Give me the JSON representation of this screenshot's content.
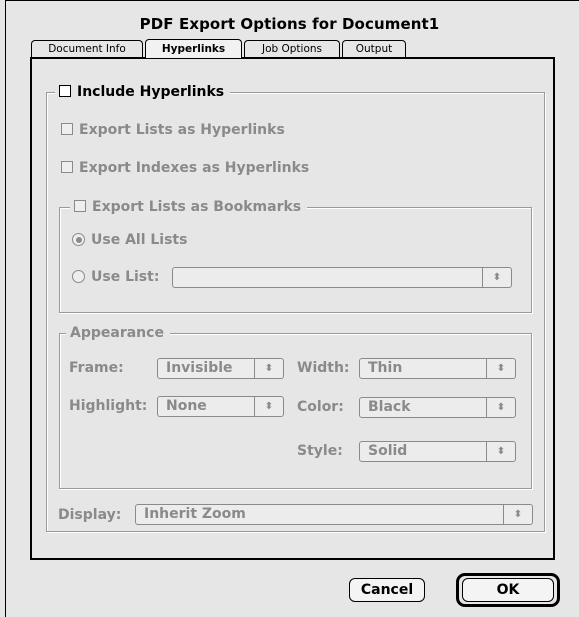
{
  "dialog": {
    "title": "PDF Export Options for Document1",
    "tabs": [
      {
        "label": "Document Info",
        "active": false
      },
      {
        "label": "Hyperlinks",
        "active": true
      },
      {
        "label": "Job Options",
        "active": false
      },
      {
        "label": "Output",
        "active": false
      }
    ]
  },
  "hyperlinks": {
    "include_label": "Include Hyperlinks",
    "include_checked": false,
    "export_lists_label": "Export Lists as Hyperlinks",
    "export_indexes_label": "Export Indexes as Hyperlinks",
    "bookmarks_group": {
      "label": "Export Lists as Bookmarks",
      "use_all_lists_label": "Use All Lists",
      "use_list_label": "Use List:",
      "use_list_value": ""
    },
    "appearance": {
      "label": "Appearance",
      "frame_label": "Frame:",
      "frame_value": "Invisible",
      "width_label": "Width:",
      "width_value": "Thin",
      "highlight_label": "Highlight:",
      "highlight_value": "None",
      "color_label": "Color:",
      "color_value": "Black",
      "style_label": "Style:",
      "style_value": "Solid"
    },
    "display_label": "Display:",
    "display_value": "Inherit Zoom"
  },
  "buttons": {
    "cancel": "Cancel",
    "ok": "OK"
  },
  "icons": {
    "popup_arrows": "updown-arrows-icon"
  },
  "colors": {
    "background": "#e6e6e6",
    "disabled_text": "#8a8a8a",
    "border": "#000000"
  }
}
